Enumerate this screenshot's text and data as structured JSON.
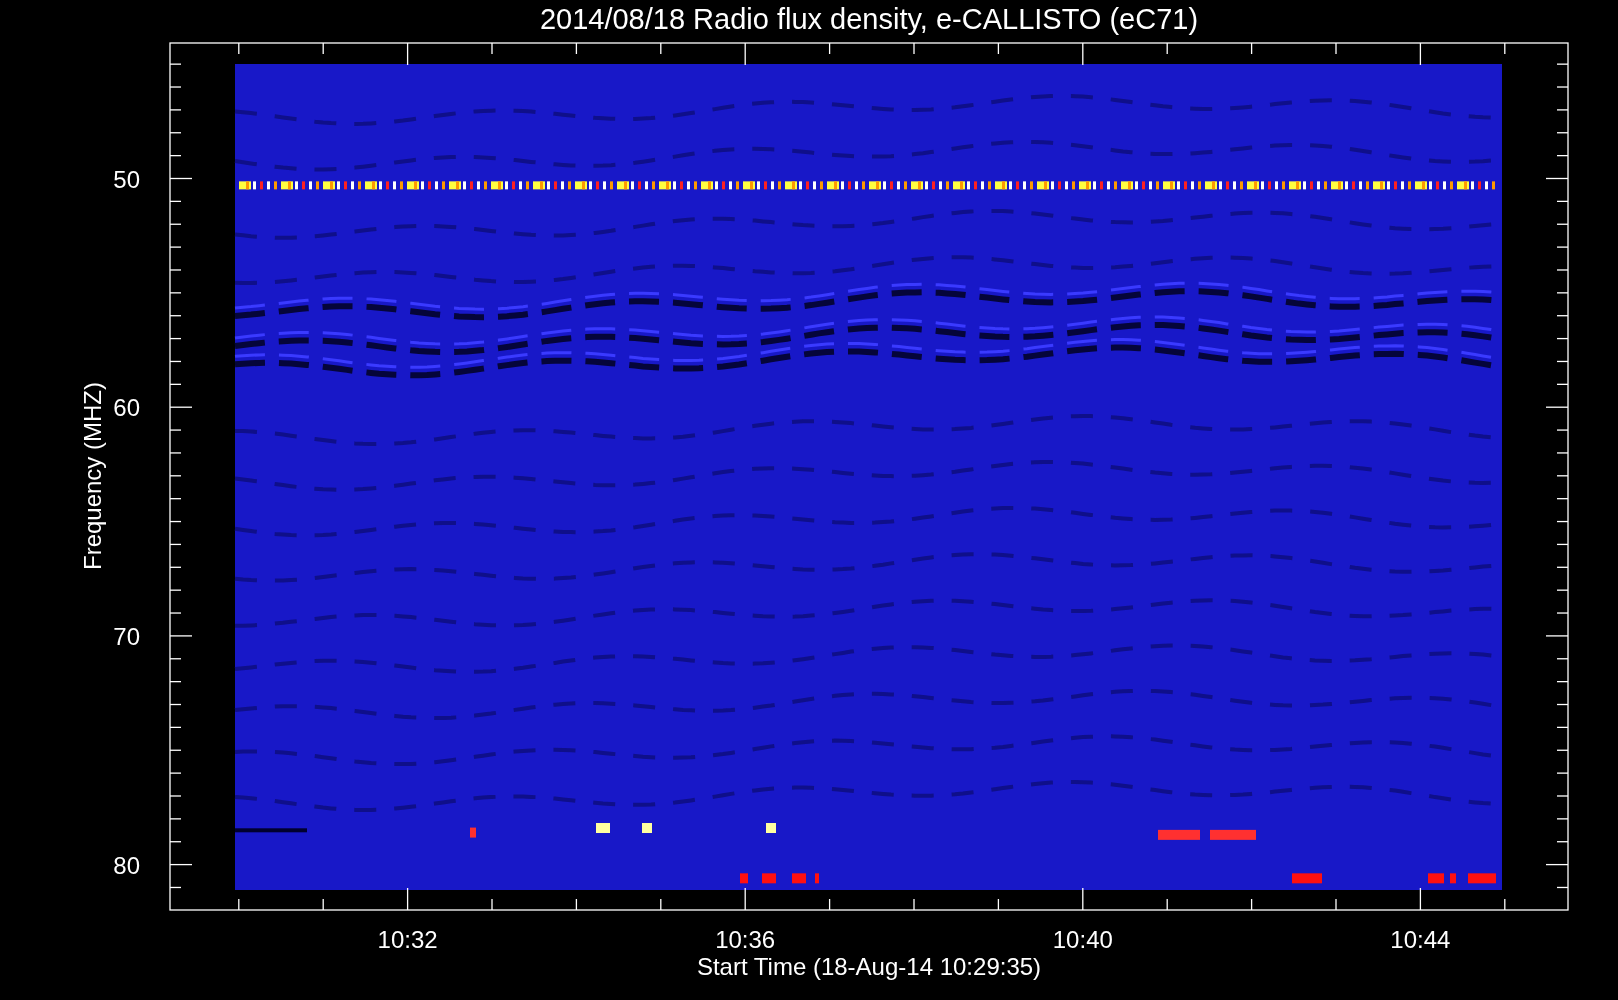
{
  "title": "2014/08/18  Radio flux density, e-CALLISTO (eC71)",
  "y_axis": {
    "label": "Frequency (MHZ)",
    "ticks": [
      "50",
      "60",
      "70",
      "80"
    ]
  },
  "x_axis": {
    "label": "Start Time (18-Aug-14 10:29:35)",
    "ticks": [
      "10:32",
      "10:36",
      "10:40",
      "10:44"
    ]
  }
}
